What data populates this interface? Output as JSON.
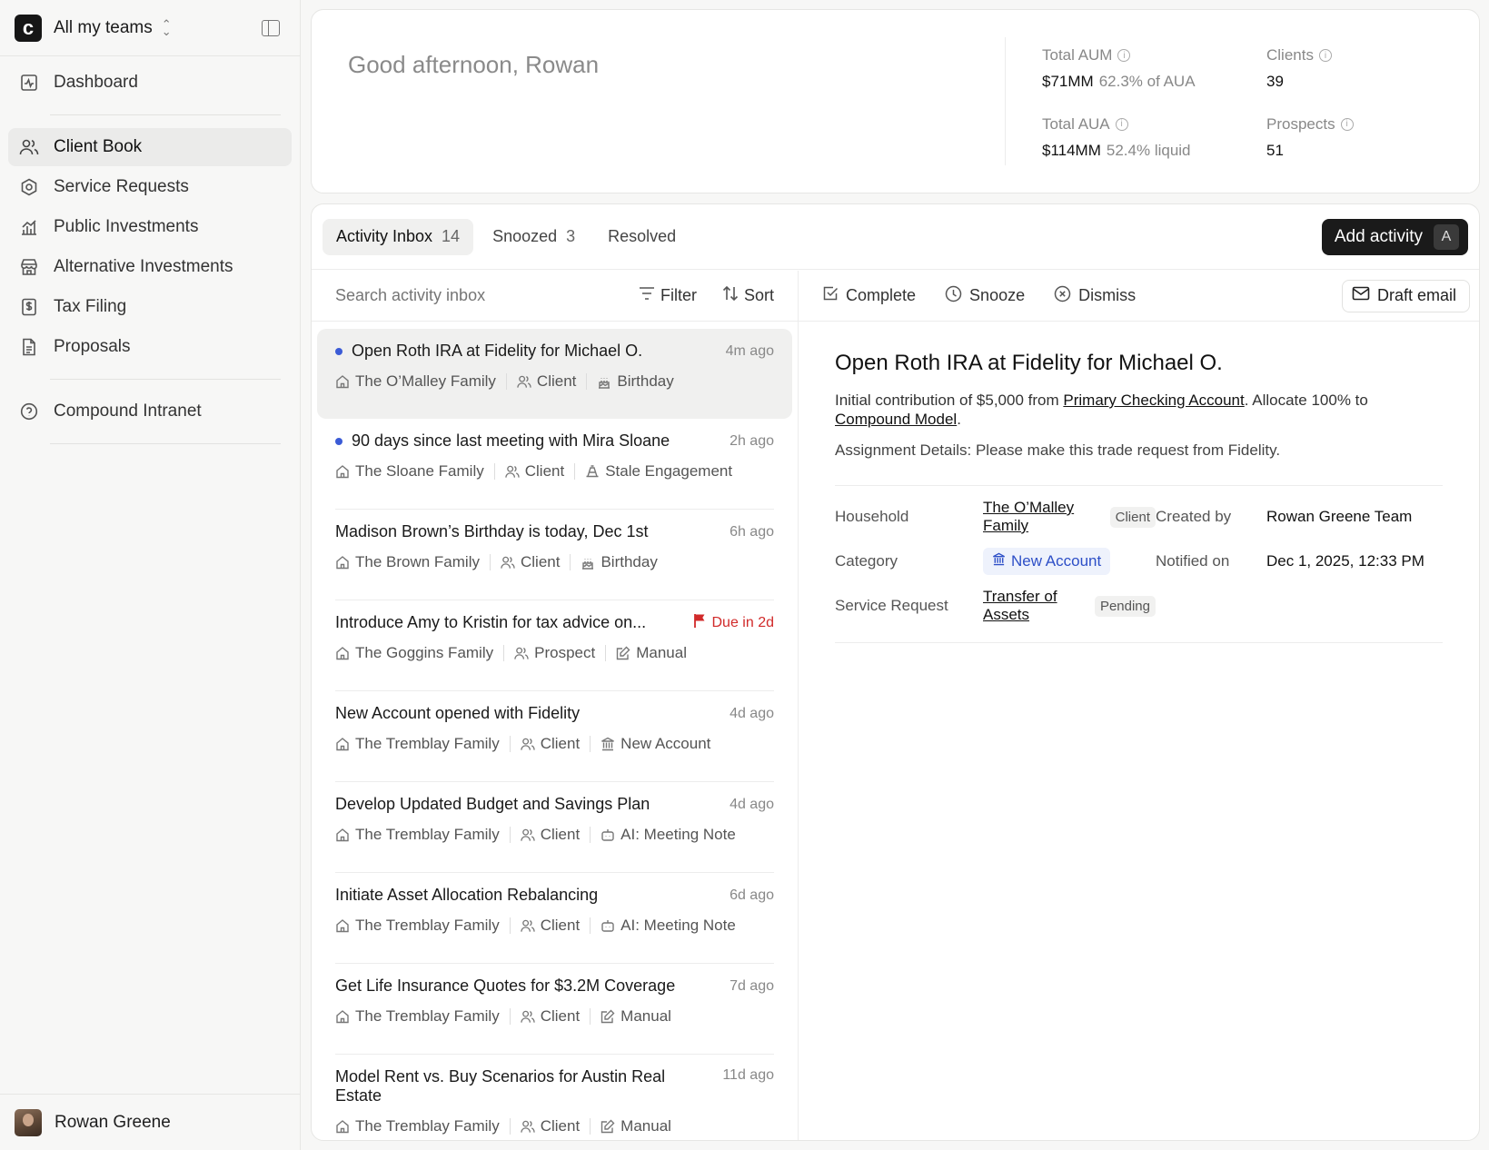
{
  "sidebar": {
    "team": "All my teams",
    "items": [
      {
        "label": "Dashboard",
        "icon": "activity-chart-icon"
      },
      {
        "label": "Client Book",
        "icon": "users-icon"
      },
      {
        "label": "Service Requests",
        "icon": "hexagon-icon"
      },
      {
        "label": "Public Investments",
        "icon": "bar-chart-icon"
      },
      {
        "label": "Alternative Investments",
        "icon": "storefront-icon"
      },
      {
        "label": "Tax Filing",
        "icon": "dollar-receipt-icon"
      },
      {
        "label": "Proposals",
        "icon": "document-icon"
      },
      {
        "label": "Compound Intranet",
        "icon": "help-circle-icon"
      }
    ],
    "user": "Rowan Greene"
  },
  "header": {
    "greeting": "Good afternoon, Rowan",
    "stats": [
      {
        "label": "Total AUM",
        "value": "$71MM",
        "sub": "62.3% of AUA"
      },
      {
        "label": "Clients",
        "value": "39",
        "sub": ""
      },
      {
        "label": "Total AUA",
        "value": "$114MM",
        "sub": "52.4% liquid"
      },
      {
        "label": "Prospects",
        "value": "51",
        "sub": ""
      }
    ]
  },
  "tabs": [
    {
      "label": "Activity Inbox",
      "count": "14"
    },
    {
      "label": "Snoozed",
      "count": "3"
    },
    {
      "label": "Resolved",
      "count": ""
    }
  ],
  "add_activity": {
    "label": "Add activity",
    "shortcut": "A"
  },
  "list_toolbar": {
    "search_placeholder": "Search activity inbox",
    "filter": "Filter",
    "sort": "Sort"
  },
  "activities": [
    {
      "title": "Open Roth IRA at Fidelity for Michael O.",
      "time": "4m ago",
      "family": "The O’Malley Family",
      "type": "Client",
      "source": "Birthday"
    },
    {
      "title": "90 days since last meeting with Mira Sloane",
      "time": "2h ago",
      "family": "The Sloane Family",
      "type": "Client",
      "source": "Stale Engagement"
    },
    {
      "title": "Madison Brown’s Birthday is today, Dec 1st",
      "time": "6h ago",
      "family": "The Brown Family",
      "type": "Client",
      "source": "Birthday"
    },
    {
      "title": "Introduce Amy to Kristin for tax advice on...",
      "time": "Due in 2d",
      "family": "The Goggins Family",
      "type": "Prospect",
      "source": "Manual"
    },
    {
      "title": "New Account opened with Fidelity",
      "time": "4d ago",
      "family": "The Tremblay Family",
      "type": "Client",
      "source": "New Account"
    },
    {
      "title": "Develop Updated Budget and Savings Plan",
      "time": "4d ago",
      "family": "The Tremblay Family",
      "type": "Client",
      "source": "AI: Meeting Note"
    },
    {
      "title": "Initiate Asset Allocation Rebalancing",
      "time": "6d ago",
      "family": "The Tremblay Family",
      "type": "Client",
      "source": "AI: Meeting Note"
    },
    {
      "title": "Get Life Insurance Quotes for $3.2M Coverage",
      "time": "7d ago",
      "family": "The Tremblay Family",
      "type": "Client",
      "source": "Manual"
    },
    {
      "title": "Model Rent vs. Buy Scenarios for Austin Real Estate",
      "time": "11d ago",
      "family": "The Tremblay Family",
      "type": "Client",
      "source": "Manual"
    }
  ],
  "detail_toolbar": {
    "complete": "Complete",
    "snooze": "Snooze",
    "dismiss": "Dismiss",
    "draft": "Draft email"
  },
  "detail": {
    "title": "Open Roth IRA at Fidelity for Michael O.",
    "body_prefix": "Initial contribution of $5,000 from ",
    "body_link1": "Primary Checking Account",
    "body_mid": ". Allocate 100% to ",
    "body_link2": "Compound Model",
    "body_suffix": ".",
    "assignment": "Assignment Details: Please make this trade request from Fidelity.",
    "household_label": "Household",
    "household_value": "The O’Malley Family",
    "household_badge": "Client",
    "created_label": "Created by",
    "created_value": "Rowan Greene Team",
    "category_label": "Category",
    "category_value": "New Account",
    "notified_label": "Notified on",
    "notified_value": "Dec 1, 2025, 12:33 PM",
    "sr_label": "Service Request",
    "sr_value": "Transfer of Assets",
    "sr_badge": "Pending"
  },
  "colors": {
    "accent": "#3b5bd6",
    "due": "#d12a2a",
    "primary_button": "#1a1a1a"
  }
}
